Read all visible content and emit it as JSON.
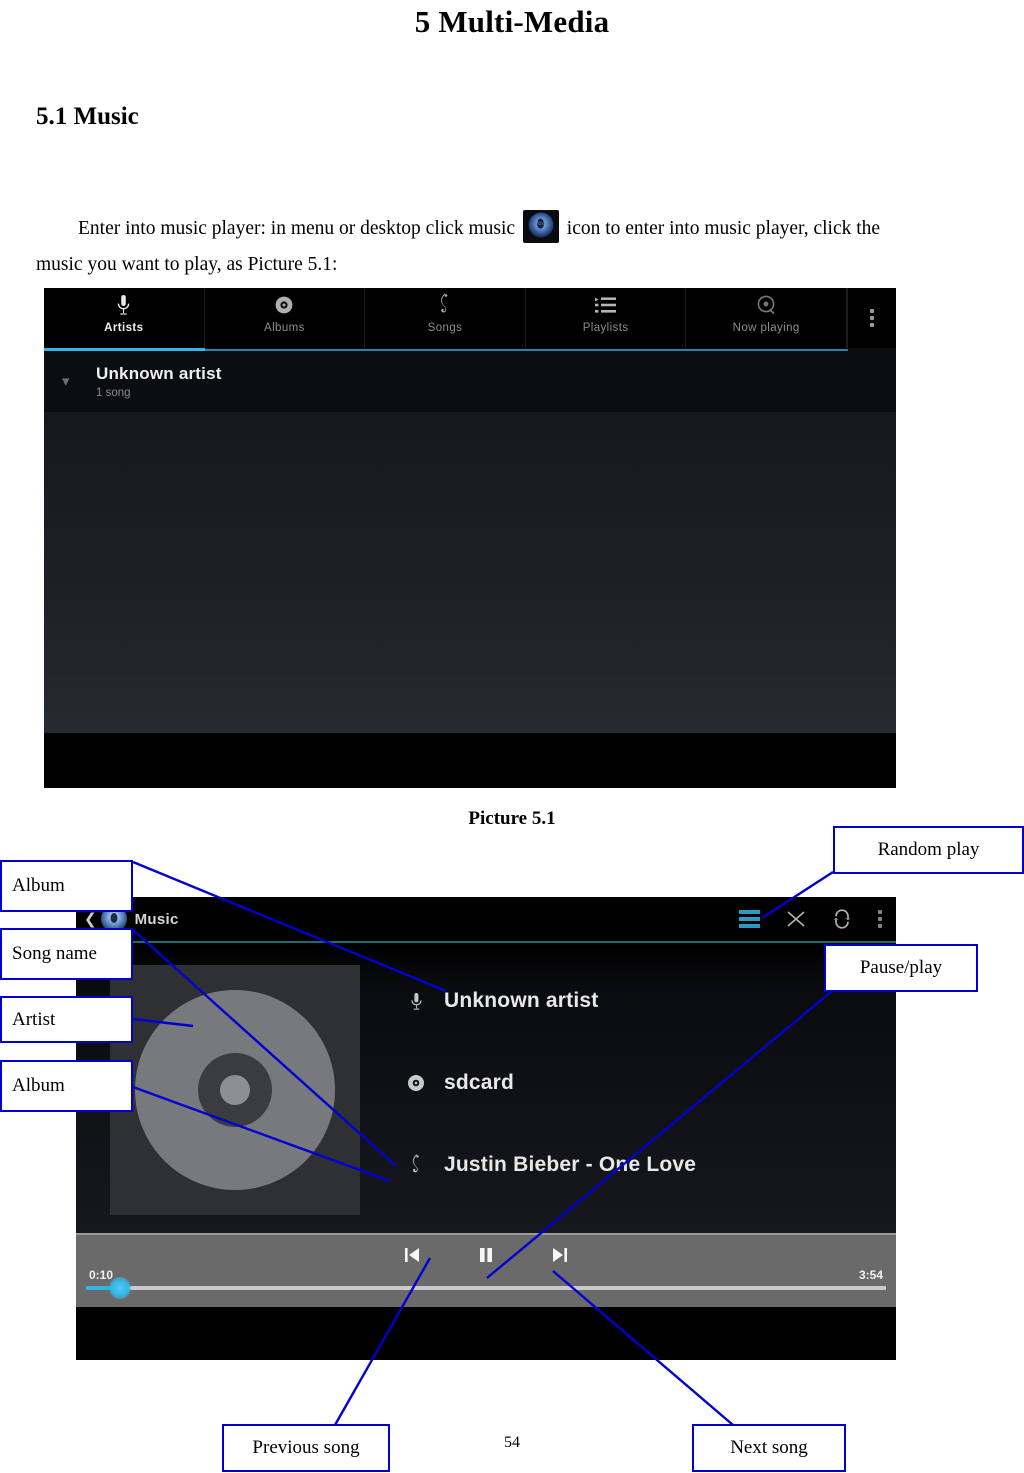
{
  "document": {
    "chapter_title": "5 Multi-Media",
    "section_title": "5.1 Music",
    "paragraph_part1": "Enter into music player: in menu or desktop click music",
    "paragraph_part2": "icon to enter into music player, click the music you want to play, as Picture 5.1:",
    "music_icon_name": "music-app-icon",
    "music_icon_label": "Music",
    "figure_caption": "Picture 5.1",
    "page_number": "54"
  },
  "library_screen": {
    "tabs": [
      {
        "label": "Artists",
        "icon": "microphone-icon",
        "active": true
      },
      {
        "label": "Albums",
        "icon": "disc-icon",
        "active": false
      },
      {
        "label": "Songs",
        "icon": "treble-clef-icon",
        "active": false
      },
      {
        "label": "Playlists",
        "icon": "playlist-icon",
        "active": false
      },
      {
        "label": "Now playing",
        "icon": "now-playing-icon",
        "active": false
      }
    ],
    "overflow_icon": "overflow-menu-icon",
    "artist_row": {
      "name": "Unknown artist",
      "song_count": "1 song",
      "expand_icon": "chevron-down-icon"
    }
  },
  "player_screen": {
    "header": {
      "back_icon": "back-arrow-icon",
      "app_icon": "music-app-icon",
      "title": "Music",
      "actions": [
        {
          "name": "queue-icon",
          "label": "Play queue"
        },
        {
          "name": "shuffle-icon",
          "label": "Shuffle"
        },
        {
          "name": "repeat-icon",
          "label": "Repeat"
        },
        {
          "name": "overflow-menu-icon",
          "label": "More options"
        }
      ]
    },
    "album_art_icon": "album-art-disc-placeholder",
    "metadata": [
      {
        "icon": "microphone-icon",
        "text": "Unknown artist"
      },
      {
        "icon": "disc-icon",
        "text": "sdcard"
      },
      {
        "icon": "treble-clef-icon",
        "text": "Justin Bieber - One Love"
      }
    ],
    "controls": {
      "previous_icon": "previous-track-icon",
      "play_pause_icon": "pause-icon",
      "next_icon": "next-track-icon",
      "elapsed_time": "0:10",
      "total_time": "3:54",
      "progress_percent": 4.3
    }
  },
  "annotations": {
    "album_top": "Album",
    "song_name": "Song name",
    "artist": "Artist",
    "album_bottom": "Album",
    "random_play": "Random play",
    "pause_play": "Pause/play",
    "previous_song": "Previous song",
    "next_song": "Next song"
  },
  "colors": {
    "accent_blue": "#33b5e5",
    "annotation_border": "#0000d0",
    "teal_rule": "#1c6b72"
  }
}
